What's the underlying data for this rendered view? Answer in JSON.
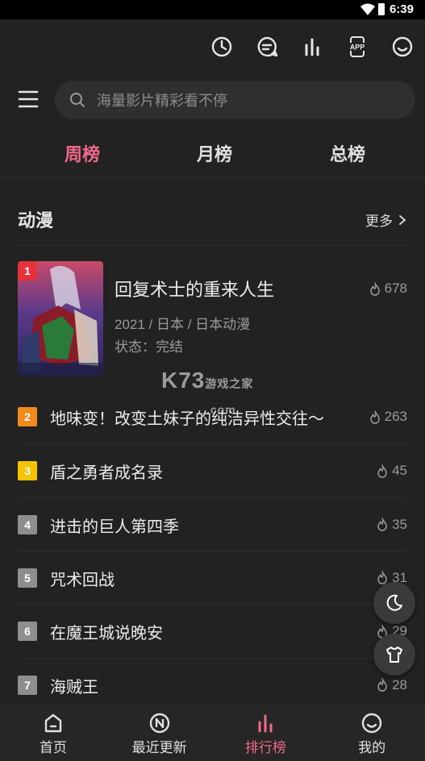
{
  "status_bar": {
    "time": "6:39"
  },
  "toolbar": {
    "icons": [
      "history-icon",
      "message-icon",
      "stats-icon",
      "app-icon",
      "smiley-icon"
    ],
    "app_label": "APP"
  },
  "search": {
    "placeholder": "海量影片精彩看不停"
  },
  "tabs": [
    {
      "label": "周榜",
      "active": true
    },
    {
      "label": "月榜",
      "active": false
    },
    {
      "label": "总榜",
      "active": false
    }
  ],
  "section": {
    "title": "动漫",
    "more_label": "更多"
  },
  "top_item": {
    "rank": "1",
    "title": "回复术士的重来人生",
    "meta": "2021 / 日本 / 日本动漫",
    "status": "状态：完结",
    "heat": "678"
  },
  "list": [
    {
      "rank": "2",
      "title": "地味变！改变土妹子的纯洁异性交往～",
      "heat": "263"
    },
    {
      "rank": "3",
      "title": "盾之勇者成名录",
      "heat": "45"
    },
    {
      "rank": "4",
      "title": "进击的巨人第四季",
      "heat": "35"
    },
    {
      "rank": "5",
      "title": "咒术回战",
      "heat": "31"
    },
    {
      "rank": "6",
      "title": "在魔王城说晚安",
      "heat": "29"
    },
    {
      "rank": "7",
      "title": "海贼王",
      "heat": "28"
    }
  ],
  "rank_colors": {
    "1": "#e6323b",
    "2": "#f28a1c",
    "3": "#f5c400",
    "other": "#8e8e8e"
  },
  "watermark": {
    "main": "K73",
    "sub": "游戏之家",
    "domain": ".com"
  },
  "bottom_nav": [
    {
      "label": "首页",
      "icon": "home-icon",
      "active": false
    },
    {
      "label": "最近更新",
      "icon": "new-icon",
      "active": false
    },
    {
      "label": "排行榜",
      "icon": "ranking-icon",
      "active": true
    },
    {
      "label": "我的",
      "icon": "profile-icon",
      "active": false
    }
  ],
  "accent_color": "#f06a8a"
}
